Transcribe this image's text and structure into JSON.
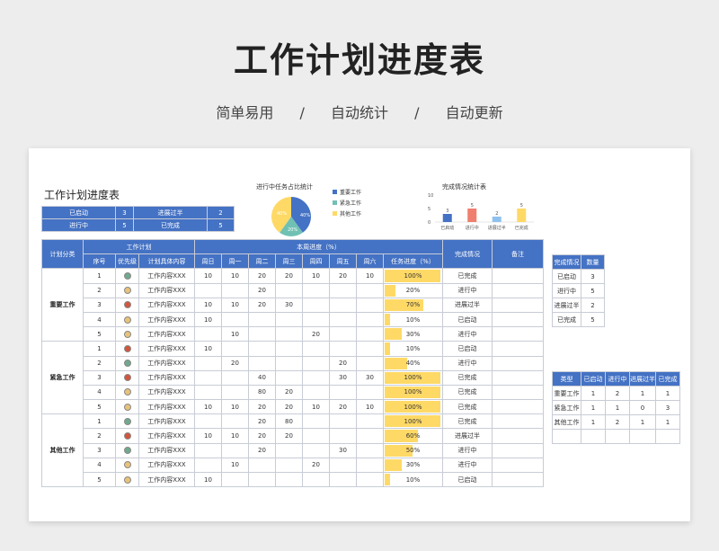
{
  "header": {
    "title": "工作计划进度表",
    "tagline": [
      "简单易用",
      "/",
      "自动统计",
      "/",
      "自动更新"
    ]
  },
  "sheet": {
    "title": "工作计划进度表",
    "summary": [
      {
        "label": "已启动",
        "value": "3",
        "label2": "进展过半",
        "value2": "2"
      },
      {
        "label": "进行中",
        "value": "5",
        "label2": "已完成",
        "value2": "5"
      }
    ],
    "pie": {
      "title": "进行中任务占比统计",
      "legend": [
        "重要工作",
        "紧急工作",
        "其他工作"
      ],
      "labels": [
        "40%",
        "20%",
        "40%"
      ],
      "colors": [
        "#4472c4",
        "#70c1b3",
        "#ffd966"
      ]
    },
    "bar_chart": {
      "title": "完成情况统计表",
      "colors": [
        "#4472c4",
        "#f07e6e",
        "#8fc1ef",
        "#ffd966"
      ]
    },
    "chart_data": {
      "type": "bar",
      "title": "完成情况统计表",
      "categories": [
        "已启动",
        "进行中",
        "进展过半",
        "已完成"
      ],
      "values": [
        3,
        5,
        2,
        5
      ],
      "ylim": [
        0,
        5
      ],
      "yticks": [
        "0",
        "5",
        "10"
      ]
    },
    "table": {
      "col_category": "计划分类",
      "group_plan": "工作计划",
      "group_week": "本周进度（%）",
      "col_status": "完成情况",
      "col_note": "备注",
      "sub": [
        "序号",
        "优先级",
        "计划具体内容",
        "周日",
        "周一",
        "周二",
        "周三",
        "周四",
        "周五",
        "周六",
        "任务进度（%）"
      ],
      "groups": [
        {
          "name": "重要工作",
          "rows": [
            {
              "no": "1",
              "dot": "#70a98e",
              "content": "工作内容XXX",
              "d": [
                "10",
                "10",
                "20",
                "20",
                "10",
                "20",
                "10"
              ],
              "pct": "100%",
              "fill": 1.0,
              "status": "已完成"
            },
            {
              "no": "2",
              "dot": "#e8c27a",
              "content": "工作内容XXX",
              "d": [
                "",
                "",
                "20",
                "",
                "",
                "",
                ""
              ],
              "pct": "20%",
              "fill": 0.2,
              "status": "进行中"
            },
            {
              "no": "3",
              "dot": "#d2553d",
              "content": "工作内容XXX",
              "d": [
                "10",
                "10",
                "20",
                "30",
                "",
                "",
                ""
              ],
              "pct": "70%",
              "fill": 0.7,
              "status": "进展过半"
            },
            {
              "no": "4",
              "dot": "#e8c27a",
              "content": "工作内容XXX",
              "d": [
                "10",
                "",
                "",
                "",
                "",
                "",
                ""
              ],
              "pct": "10%",
              "fill": 0.1,
              "status": "已启动"
            },
            {
              "no": "5",
              "dot": "#e8c27a",
              "content": "工作内容XXX",
              "d": [
                "",
                "10",
                "",
                "",
                "20",
                "",
                ""
              ],
              "pct": "30%",
              "fill": 0.3,
              "status": "进行中"
            }
          ]
        },
        {
          "name": "紧急工作",
          "rows": [
            {
              "no": "1",
              "dot": "#d2553d",
              "content": "工作内容XXX",
              "d": [
                "10",
                "",
                "",
                "",
                "",
                "",
                ""
              ],
              "pct": "10%",
              "fill": 0.1,
              "status": "已启动"
            },
            {
              "no": "2",
              "dot": "#70a98e",
              "content": "工作内容XXX",
              "d": [
                "",
                "20",
                "",
                "",
                "",
                "20",
                ""
              ],
              "pct": "40%",
              "fill": 0.4,
              "status": "进行中"
            },
            {
              "no": "3",
              "dot": "#d2553d",
              "content": "工作内容XXX",
              "d": [
                "",
                "",
                "40",
                "",
                "",
                "30",
                "30"
              ],
              "pct": "100%",
              "fill": 1.0,
              "status": "已完成"
            },
            {
              "no": "4",
              "dot": "#e8c27a",
              "content": "工作内容XXX",
              "d": [
                "",
                "",
                "80",
                "20",
                "",
                "",
                ""
              ],
              "pct": "100%",
              "fill": 1.0,
              "status": "已完成"
            },
            {
              "no": "5",
              "dot": "#e8c27a",
              "content": "工作内容XXX",
              "d": [
                "10",
                "10",
                "20",
                "20",
                "10",
                "20",
                "10"
              ],
              "pct": "100%",
              "fill": 1.0,
              "status": "已完成"
            }
          ]
        },
        {
          "name": "其他工作",
          "rows": [
            {
              "no": "1",
              "dot": "#70a98e",
              "content": "工作内容XXX",
              "d": [
                "",
                "",
                "20",
                "80",
                "",
                "",
                ""
              ],
              "pct": "100%",
              "fill": 1.0,
              "status": "已完成"
            },
            {
              "no": "2",
              "dot": "#d2553d",
              "content": "工作内容XXX",
              "d": [
                "10",
                "10",
                "20",
                "20",
                "",
                "",
                ""
              ],
              "pct": "60%",
              "fill": 0.6,
              "status": "进展过半"
            },
            {
              "no": "3",
              "dot": "#70a98e",
              "content": "工作内容XXX",
              "d": [
                "",
                "",
                "20",
                "",
                "",
                "30",
                ""
              ],
              "pct": "50%",
              "fill": 0.5,
              "status": "进行中"
            },
            {
              "no": "4",
              "dot": "#e8c27a",
              "content": "工作内容XXX",
              "d": [
                "",
                "10",
                "",
                "",
                "20",
                "",
                ""
              ],
              "pct": "30%",
              "fill": 0.3,
              "status": "进行中"
            },
            {
              "no": "5",
              "dot": "#e8c27a",
              "content": "工作内容XXX",
              "d": [
                "10",
                "",
                "",
                "",
                "",
                "",
                ""
              ],
              "pct": "10%",
              "fill": 0.1,
              "status": "已启动"
            }
          ]
        }
      ]
    },
    "side_status": {
      "headers": [
        "完成情况",
        "数量"
      ],
      "rows": [
        [
          "已启动",
          "3"
        ],
        [
          "进行中",
          "5"
        ],
        [
          "进展过半",
          "2"
        ],
        [
          "已完成",
          "5"
        ]
      ]
    },
    "side_type": {
      "headers": [
        "类型",
        "已启动",
        "进行中",
        "进展过半",
        "已完成"
      ],
      "rows": [
        [
          "重要工作",
          "1",
          "2",
          "1",
          "1"
        ],
        [
          "紧急工作",
          "1",
          "1",
          "0",
          "3"
        ],
        [
          "其他工作",
          "1",
          "2",
          "1",
          "1"
        ],
        [
          "",
          "",
          "",
          "",
          ""
        ]
      ]
    }
  }
}
